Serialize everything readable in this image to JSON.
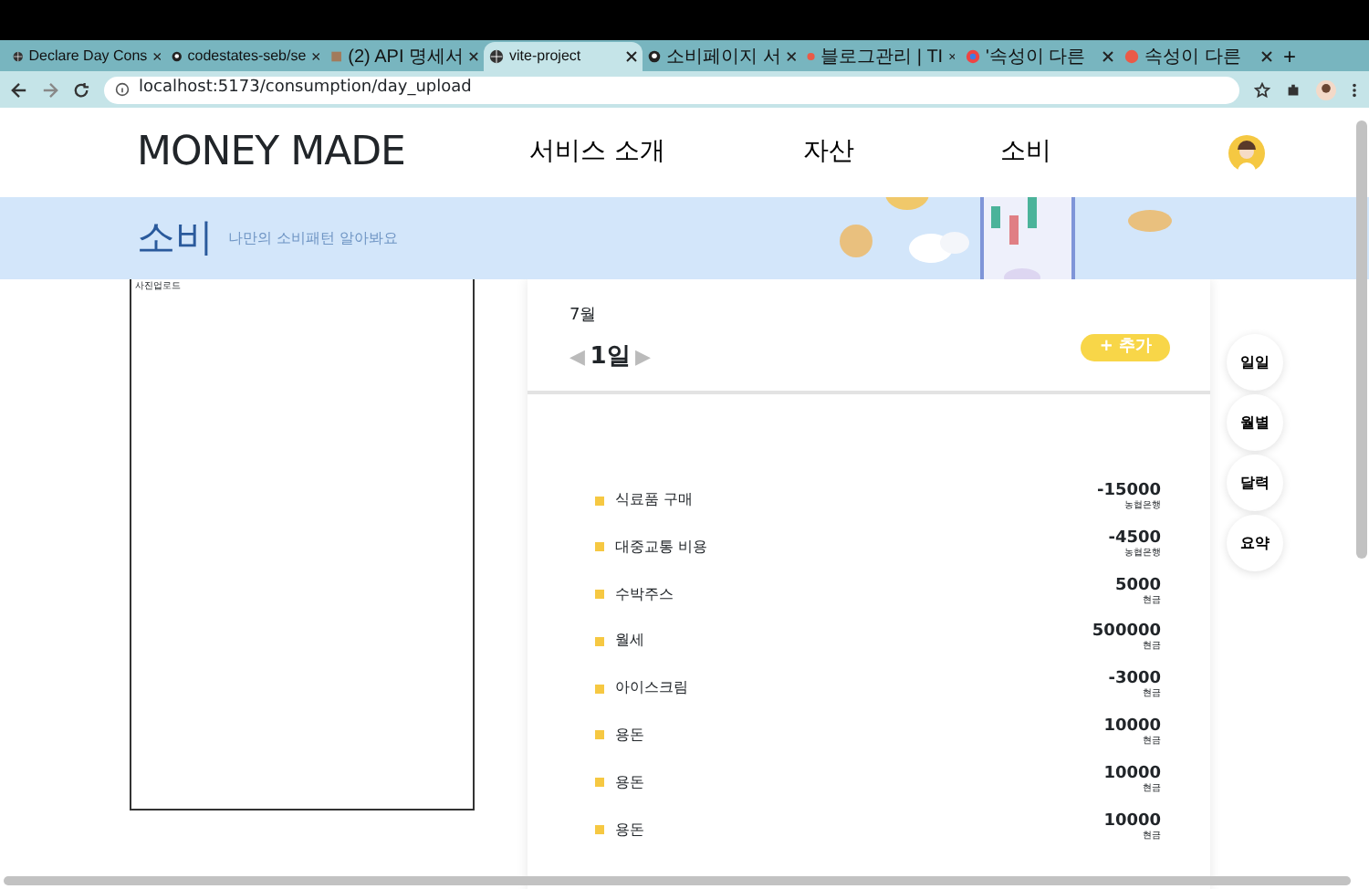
{
  "browser": {
    "tabs": [
      {
        "label": "Declare Day Cons",
        "selected": false,
        "kind": "globe"
      },
      {
        "label": "codestates-seb/se",
        "selected": false,
        "kind": "github"
      },
      {
        "label": "(2) API 명세서",
        "selected": false,
        "kind": "doc"
      },
      {
        "label": "vite-project",
        "selected": true,
        "kind": "globe"
      },
      {
        "label": "소비페이지 서",
        "selected": false,
        "kind": "github"
      },
      {
        "label": "블로그관리 | TI",
        "selected": false,
        "kind": "tistory"
      },
      {
        "label": "'속성이 다른",
        "selected": false,
        "kind": "chrome"
      },
      {
        "label": "속성이 다른",
        "selected": false,
        "kind": "tistory"
      }
    ],
    "new_tab": "+",
    "address": "localhost:5173/consumption/day_upload"
  },
  "header": {
    "logo": "MONEY MADE",
    "nav": [
      "서비스 소개",
      "자산",
      "소비"
    ]
  },
  "banner": {
    "title": "소비",
    "subtitle": "나만의 소비패턴 알아봐요"
  },
  "upload_box": {
    "label": "사진업로드"
  },
  "day_panel": {
    "month": "7월",
    "prev": "◀",
    "day": "1일",
    "next": "▶",
    "add_button": "+ 추가"
  },
  "entries": [
    {
      "name": "식료품 구매",
      "amount": "-15000",
      "source": "농협은행"
    },
    {
      "name": "대중교통 비용",
      "amount": "-4500",
      "source": "농협은행"
    },
    {
      "name": "수박주스",
      "amount": "5000",
      "source": "현금"
    },
    {
      "name": "월세",
      "amount": "500000",
      "source": "현금"
    },
    {
      "name": "아이스크림",
      "amount": "-3000",
      "source": "현금"
    },
    {
      "name": "용돈",
      "amount": "10000",
      "source": "현금"
    },
    {
      "name": "용돈",
      "amount": "10000",
      "source": "현금"
    },
    {
      "name": "용돈",
      "amount": "10000",
      "source": "현금"
    }
  ],
  "view_buttons": [
    "일일",
    "월별",
    "달력",
    "요약"
  ]
}
